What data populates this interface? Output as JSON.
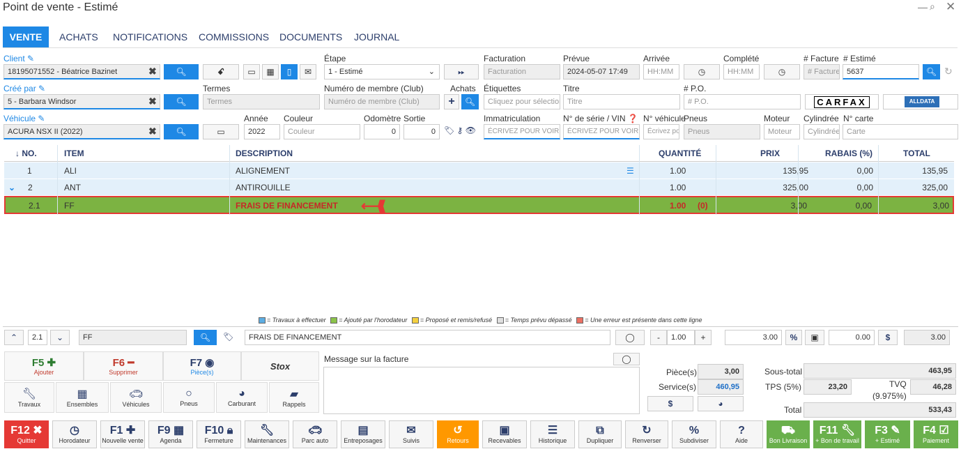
{
  "window": {
    "title": "Point de vente - Estimé"
  },
  "tabs": [
    "VENTE",
    "ACHATS",
    "NOTIFICATIONS",
    "COMMISSIONS",
    "DOCUMENTS",
    "JOURNAL"
  ],
  "form": {
    "client_label": "Client",
    "client_value": "18195071552 - Béatrice Bazinet",
    "etape_label": "Étape",
    "etape_value": "1 - Estimé",
    "facturation_label": "Facturation",
    "facturation_ph": "Facturation",
    "prevue_label": "Prévue",
    "prevue_value": "2024-05-07 17:49",
    "arrivee_label": "Arrivée",
    "arrivee_ph": "HH:MM",
    "complete_label": "Complété",
    "complete_ph": "HH:MM",
    "facture_label": "# Facture",
    "facture_ph": "# Facture",
    "estime_label": "# Estimé",
    "estime_value": "5637",
    "cree_par_label": "Créé par",
    "cree_par_value": "5 - Barbara Windsor",
    "termes_label": "Termes",
    "termes_ph": "Termes",
    "membre_label": "Numéro de membre (Club)",
    "membre_ph": "Numéro de membre (Club)",
    "achats_label": "Achats",
    "etiquettes_label": "Étiquettes",
    "etiquettes_ph": "Cliquez pour sélection",
    "titre_label": "Titre",
    "titre_ph": "Titre",
    "po_label": "# P.O.",
    "po_ph": "# P.O.",
    "carfax": "CARFAX",
    "alldata": "ALLDATA",
    "vehicule_label": "Véhicule",
    "vehicule_value": "ACURA NSX II (2022)",
    "annee_label": "Année",
    "annee_value": "2022",
    "couleur_label": "Couleur",
    "couleur_ph": "Couleur",
    "odometre_label": "Odomètre",
    "odometre_value": "0",
    "sortie_label": "Sortie",
    "sortie_value": "0",
    "immat_label": "Immatriculation",
    "immat_ph": "ÉCRIVEZ POUR VOIR L",
    "vin_label": "N° de série / VIN",
    "vin_ph": "ÉCRIVEZ POUR VOIR L",
    "nveh_label": "N° véhicule",
    "nveh_ph": "Écrivez po",
    "pneus_label": "Pneus",
    "pneus_ph": "Pneus",
    "moteur_label": "Moteur",
    "moteur_ph": "Moteur",
    "cylindree_label": "Cylindrée",
    "cylindree_ph": "Cylindrée",
    "ncarte_label": "N° carte",
    "ncarte_ph": "Carte"
  },
  "table": {
    "headers": [
      "↓ NO.",
      "ITEM",
      "DESCRIPTION",
      "QUANTITÉ",
      "PRIX",
      "RABAIS (%)",
      "TOTAL"
    ],
    "rows": [
      {
        "no": "1",
        "item": "ALI",
        "desc": "ALIGNEMENT",
        "qty": "1.00",
        "prix": "135,95",
        "rabais": "0,00",
        "total": "135,95"
      },
      {
        "no": "2",
        "item": "ANT",
        "desc": "ANTIROUILLE",
        "qty": "1.00",
        "prix": "325,00",
        "rabais": "0,00",
        "total": "325,00"
      },
      {
        "no": "2.1",
        "item": "FF",
        "desc": "FRAIS DE FINANCEMENT",
        "qty": "1.00",
        "qty_extra": "(0)",
        "prix": "3,00",
        "rabais": "0,00",
        "total": "3,00"
      }
    ]
  },
  "legend": [
    {
      "color": "#5dade2",
      "text": "= Travaux à effectuer"
    },
    {
      "color": "#8bc34a",
      "text": "= Ajouté par l'horodateur"
    },
    {
      "color": "#f4d03f",
      "text": "= Proposé et remis/refusé"
    },
    {
      "color": "#e0e0e0",
      "text": "= Temps prévu dépassé"
    },
    {
      "color": "#ec7063",
      "text": "= Une erreur est présente dans cette ligne"
    }
  ],
  "edit": {
    "line": "2.1",
    "code": "FF",
    "desc": "FRAIS DE FINANCEMENT",
    "qty": "1.00",
    "prix": "3.00",
    "rabais": "0.00",
    "total": "3.00",
    "minus": "-",
    "plus": "+",
    "pct": "%",
    "dollar": "$"
  },
  "tiles": [
    {
      "key": "F5",
      "label": "Ajouter"
    },
    {
      "key": "F6",
      "label": "Supprimer"
    },
    {
      "key": "F7",
      "label": "Pièce(s)"
    }
  ],
  "tiles2": [
    "Travaux",
    "Ensembles",
    "Véhicules",
    "Pneus",
    "Carburant",
    "Rappels"
  ],
  "message_label": "Message sur la facture",
  "totals": {
    "pieces_label": "Pièce(s)",
    "pieces": "3,00",
    "service_label": "Service(s)",
    "service": "460,95",
    "sous_total_label": "Sous-total",
    "sous_total": "463,95",
    "tps_label": "TPS (5%)",
    "tps": "23,20",
    "tvq_label": "TVQ",
    "tvq_rate": "(9.975%)",
    "tvq": "46,28",
    "total_label": "Total",
    "total": "533,43"
  },
  "fkeys": [
    {
      "key": "F12",
      "label": "Quitter"
    },
    {
      "key": "",
      "label": "Horodateur"
    },
    {
      "key": "F1",
      "label": "Nouvelle vente"
    },
    {
      "key": "F9",
      "label": "Agenda"
    },
    {
      "key": "F10",
      "label": "Fermeture"
    },
    {
      "key": "",
      "label": "Maintenances"
    },
    {
      "key": "",
      "label": "Parc auto"
    },
    {
      "key": "",
      "label": "Entreposages"
    },
    {
      "key": "",
      "label": "Suivis"
    },
    {
      "key": "",
      "label": "Retours"
    },
    {
      "key": "",
      "label": "Recevables"
    },
    {
      "key": "",
      "label": "Historique"
    },
    {
      "key": "",
      "label": "Dupliquer"
    },
    {
      "key": "",
      "label": "Renverser"
    },
    {
      "key": "",
      "label": "Subdiviser"
    },
    {
      "key": "",
      "label": "Aide"
    },
    {
      "key": "",
      "label": "Bon Livraison"
    },
    {
      "key": "F11",
      "label": "+ Bon de travail"
    },
    {
      "key": "F3",
      "label": "+ Estimé"
    },
    {
      "key": "F4",
      "label": "Paiement"
    }
  ]
}
